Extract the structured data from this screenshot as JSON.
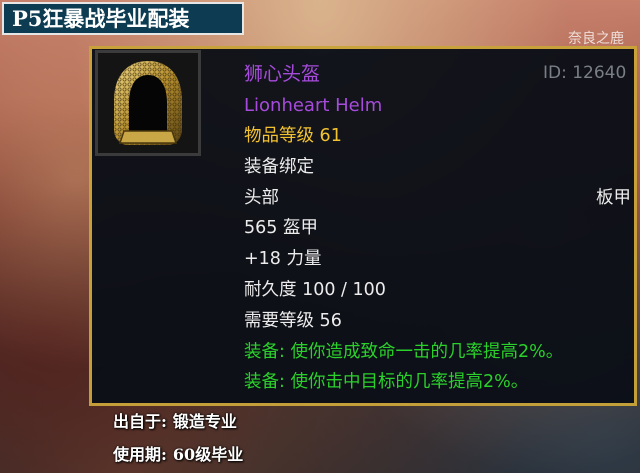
{
  "banner": {
    "title": "P5狂暴战毕业配装"
  },
  "watermark": "奈良之鹿",
  "item": {
    "icon": "plate-helm-icon",
    "name_cn": "狮心头盔",
    "id_label": "ID: 12640",
    "name_en": "Lionheart Helm",
    "item_level": "物品等级 61",
    "bind": "装备绑定",
    "slot": "头部",
    "armor_type": "板甲",
    "armor": "565 盔甲",
    "stat": "+18 力量",
    "durability": "耐久度 100 / 100",
    "required_level": "需要等级 56",
    "effects": [
      "装备: 使你造成致命一击的几率提高2%。",
      "装备: 使你击中目标的几率提高2%。"
    ]
  },
  "info": {
    "source_label": "出自于:",
    "source_value": "锻造专业",
    "period_label": "使用期:",
    "period_value": "60级毕业"
  },
  "colors": {
    "epic": "#a64bdb",
    "item_level": "#f2c230",
    "equip_effect": "#2bd12b",
    "border": "#c9a33a",
    "banner_bg": "#0d3b52"
  }
}
